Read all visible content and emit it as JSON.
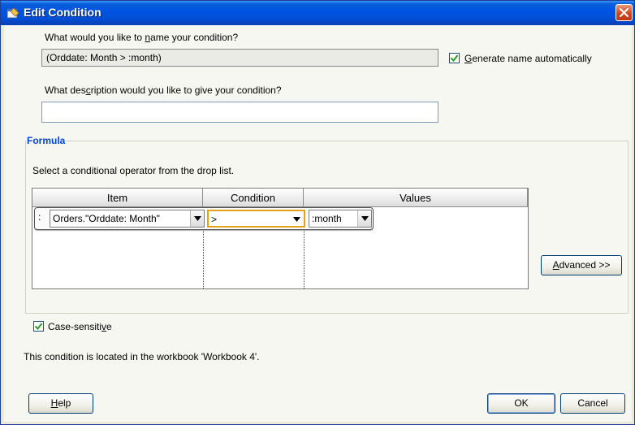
{
  "window": {
    "title": "Edit Condition",
    "close_label": "close"
  },
  "name_section": {
    "question": "What would you like to name your condition?",
    "name_value": "(Orddate: Month > :month)",
    "auto_name_label": "Generate name automatically",
    "auto_name_checked": true
  },
  "description_section": {
    "question": "What description would you like to give your condition?",
    "value": ""
  },
  "formula": {
    "legend": "Formula",
    "instruction": "Select a conditional operator from the drop list.",
    "columns": [
      "Item",
      "Condition",
      "Values"
    ],
    "row": {
      "handle": ":",
      "item": "Orders.\"Orddate: Month\"",
      "condition": ">",
      "value": ":month"
    },
    "advanced_label": "Advanced >>",
    "case_sensitive_label": "Case-sensitive",
    "case_sensitive_checked": true
  },
  "location_text": "This condition is located in the workbook 'Workbook 4'.",
  "buttons": {
    "help": "Help",
    "ok": "OK",
    "cancel": "Cancel"
  },
  "colors": {
    "titlebar": "#0054e3",
    "legend": "#0046d5",
    "focus_border": "#e3a21a",
    "check": "#21a121"
  },
  "icons": {
    "title": "dialog-icon",
    "close": "close-icon",
    "dropdown": "chevron-down-icon",
    "check": "check-icon"
  }
}
